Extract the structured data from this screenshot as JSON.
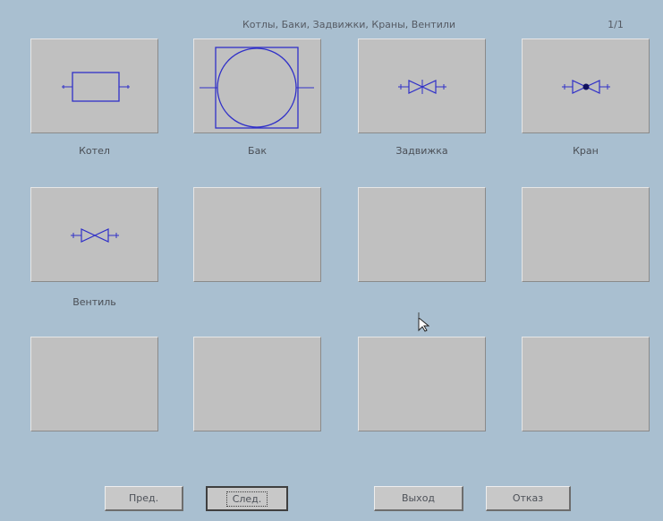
{
  "header": {
    "title": "Котлы, Баки, Задвижки, Краны, Вентили",
    "page_indicator": "1/1"
  },
  "tiles": [
    {
      "label": "Котел",
      "icon": "boiler-icon"
    },
    {
      "label": "Бак",
      "icon": "tank-icon"
    },
    {
      "label": "Задвижка",
      "icon": "gate-valve-icon"
    },
    {
      "label": "Кран",
      "icon": "ball-valve-icon"
    },
    {
      "label": "Вентиль",
      "icon": "globe-valve-icon"
    },
    {
      "label": ""
    },
    {
      "label": ""
    },
    {
      "label": ""
    },
    {
      "label": ""
    },
    {
      "label": ""
    },
    {
      "label": ""
    },
    {
      "label": ""
    }
  ],
  "buttons": {
    "prev": "Пред.",
    "next": "След.",
    "exit": "Выход",
    "cancel": "Отказ"
  },
  "colors": {
    "background": "#a9bfd0",
    "tile": "#c0c0c0",
    "symbol": "#3030c8"
  }
}
